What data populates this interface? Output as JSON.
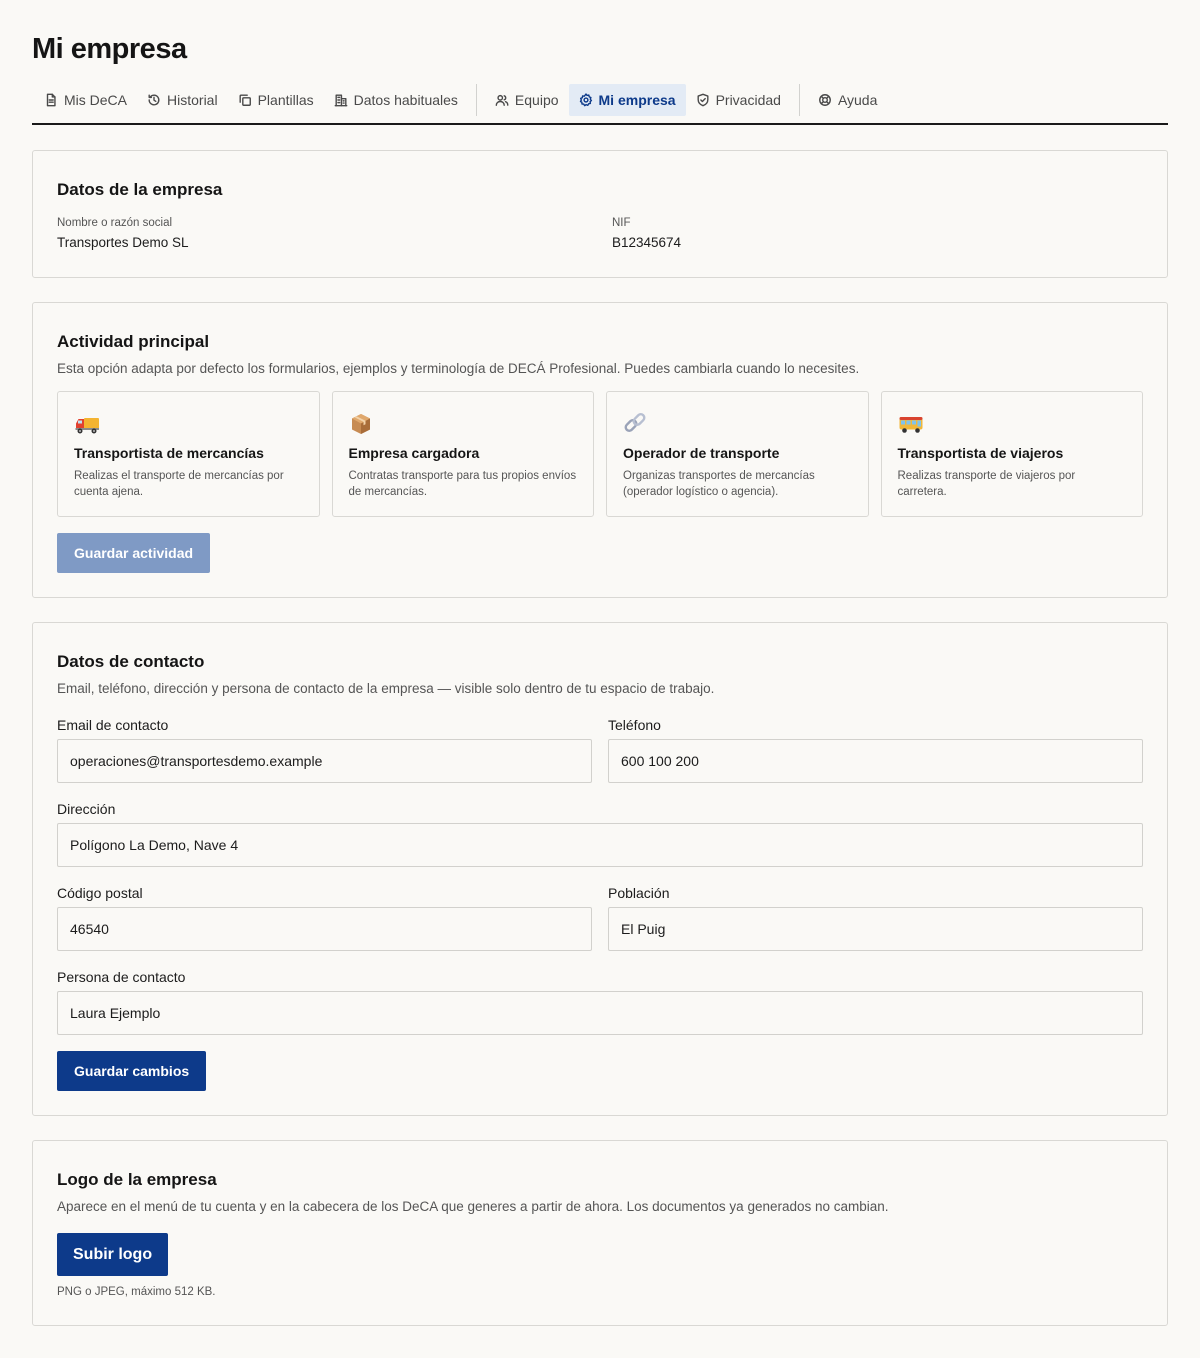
{
  "page": {
    "title": "Mi empresa"
  },
  "nav": {
    "tabs": [
      {
        "label": "Mis DeCA",
        "icon": "document-icon"
      },
      {
        "label": "Historial",
        "icon": "history-icon"
      },
      {
        "label": "Plantillas",
        "icon": "copy-icon"
      },
      {
        "label": "Datos habituales",
        "icon": "building-icon"
      },
      {
        "label": "Equipo",
        "icon": "users-icon"
      },
      {
        "label": "Mi empresa",
        "icon": "gear-icon",
        "active": true
      },
      {
        "label": "Privacidad",
        "icon": "shield-icon"
      },
      {
        "label": "Ayuda",
        "icon": "lifebuoy-icon"
      }
    ]
  },
  "company": {
    "title": "Datos de la empresa",
    "name_label": "Nombre o razón social",
    "name_value": "Transportes Demo SL",
    "nif_label": "NIF",
    "nif_value": "B12345674"
  },
  "activity": {
    "title": "Actividad principal",
    "description": "Esta opción adapta por defecto los formularios, ejemplos y terminología de DECÁ Profesional. Puedes cambiarla cuando lo necesites.",
    "options": [
      {
        "icon": "truck-icon",
        "name": "Transportista de mercancías",
        "sub": "Realizas el transporte de mercancías por cuenta ajena."
      },
      {
        "icon": "package-icon",
        "name": "Empresa cargadora",
        "sub": "Contratas transporte para tus propios envíos de mercancías."
      },
      {
        "icon": "link-icon",
        "name": "Operador de transporte",
        "sub": "Organizas transportes de mercancías (operador logístico o agencia)."
      },
      {
        "icon": "bus-icon",
        "name": "Transportista de viajeros",
        "sub": "Realizas transporte de viajeros por carretera."
      }
    ],
    "save_label": "Guardar actividad"
  },
  "contact": {
    "title": "Datos de contacto",
    "description": "Email, teléfono, dirección y persona de contacto de la empresa — visible solo dentro de tu espacio de trabajo.",
    "email_label": "Email de contacto",
    "email_value": "operaciones@transportesdemo.example",
    "phone_label": "Teléfono",
    "phone_value": "600 100 200",
    "address_label": "Dirección",
    "address_value": "Polígono La Demo, Nave 4",
    "postal_label": "Código postal",
    "postal_value": "46540",
    "city_label": "Población",
    "city_value": "El Puig",
    "person_label": "Persona de contacto",
    "person_value": "Laura Ejemplo",
    "save_label": "Guardar cambios"
  },
  "logo": {
    "title": "Logo de la empresa",
    "description": "Aparece en el menú de tu cuenta y en la cabecera de los DeCA que generes a partir de ahora. Los documentos ya generados no cambian.",
    "upload_label": "Subir logo",
    "hint": "PNG o JPEG, máximo 512 KB."
  },
  "colors": {
    "primary": "#0d3a8a",
    "primary_disabled": "#7f9ac5",
    "active_tab_bg": "#e3ebf5",
    "background": "#faf9f6"
  }
}
